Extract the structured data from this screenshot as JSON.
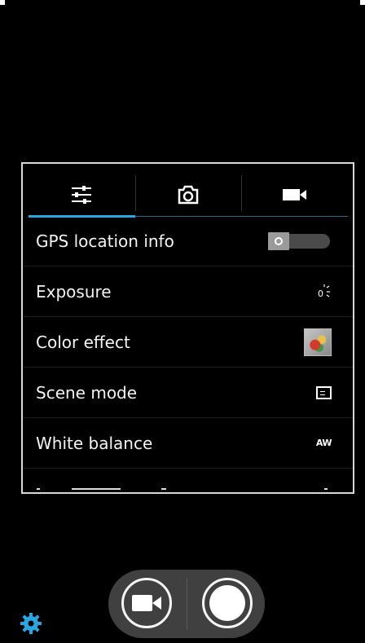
{
  "settings": {
    "tabs": [
      {
        "icon": "sliders-icon",
        "active": true
      },
      {
        "icon": "camera-icon",
        "active": false
      },
      {
        "icon": "video-camera-icon",
        "active": false
      }
    ],
    "rows": [
      {
        "label": "GPS location info",
        "control": "toggle"
      },
      {
        "label": "Exposure",
        "control": "exposure-icon",
        "value": "0"
      },
      {
        "label": "Color effect",
        "control": "color-effect-thumbnail"
      },
      {
        "label": "Scene mode",
        "control": "scene-mode-icon"
      },
      {
        "label": "White balance",
        "control": "white-balance-icon",
        "value": "AW"
      }
    ]
  },
  "controls": {
    "video_icon": "video-camera-icon",
    "shutter_icon": "shutter-icon",
    "settings_icon": "gear-icon"
  },
  "colors": {
    "accent": "#2aa7e0",
    "background": "#000000",
    "toggle_track": "#4a4a4a",
    "control_bar": "#404040"
  }
}
